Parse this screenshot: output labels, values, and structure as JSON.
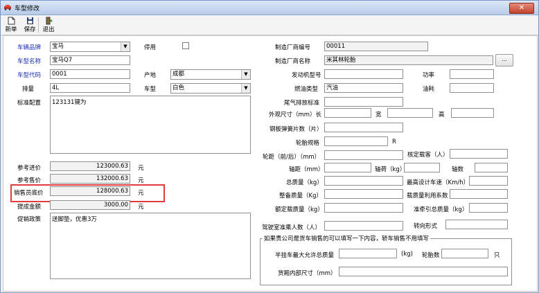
{
  "window": {
    "title": "车型修改",
    "close_glyph": "✕"
  },
  "toolbar": {
    "new_label": "新单",
    "save_label": "保存",
    "exit_label": "退出"
  },
  "left": {
    "brand_label": "车辆品牌",
    "brand_value": "宝马",
    "disabled_label": "停用",
    "model_name_label": "车型名称",
    "model_name_value": "宝马Q7",
    "model_code_label": "车型代码",
    "model_code_value": "0001",
    "origin_label": "产地",
    "origin_value": "成都",
    "displacement_label": "排量",
    "displacement_value": "4L",
    "type_label": "车型",
    "type_value": "白色",
    "config_label": "标准配置",
    "config_value": "123131键为",
    "ref_cost_label": "参考进价",
    "ref_cost_value": "123000.63",
    "ref_cost_unit": "元",
    "ref_price_label": "参考售价",
    "ref_price_value": "132000.63",
    "ref_price_unit": "元",
    "min_price_label": "销售员底价",
    "min_price_value": "128000.63",
    "min_price_unit": "元",
    "commission_label": "提成金额",
    "commission_value": "3000.00",
    "commission_unit": "元",
    "promo_label": "促销政策",
    "promo_value": "送脚垫，优惠3万"
  },
  "right": {
    "mfr_code_label": "制造厂商编号",
    "mfr_code_value": "00011",
    "mfr_name_label": "制造厂商名称",
    "mfr_name_value": "米其林轮胎",
    "browse_label": "...",
    "engine_label": "发动机型号",
    "power_label": "功率",
    "fuel_label": "燃油类型",
    "fuel_value": "汽油",
    "consumption_label": "油耗",
    "emission_label": "尾气排放标准",
    "size_label": "外观尺寸（mm）长",
    "width_label": "宽",
    "height_label": "高",
    "spring_label": "钢板弹簧片数（片）",
    "tire_label": "轮胎规格",
    "tire_unit": "R",
    "track_label": "轮距（前/后）（mm）",
    "seats_label": "核定载客（人）",
    "wheelbase_label": "轴距（mm）",
    "axleload_label": "轴荷（kg）",
    "axles_label": "轴数",
    "total_mass_label": "总质量（kg）",
    "max_speed_label": "最高设计车速（Km/h）",
    "curb_mass_label": "整备质量（Kg）",
    "load_util_label": "载质量利用系数",
    "rated_load_label": "额定载质量（kg）",
    "tow_mass_label": "准牵引总质量（kg）",
    "cab_pass_label": "驾驶室准乘人数（人）",
    "steering_label": "转向形式",
    "group_title": "如果贵公司是货车销售的可以填写一下内容，轿车销售不用填写",
    "semi_mass_label": "半挂车最大允许总质量",
    "semi_unit": "(kg)",
    "tire_count_label": "轮胎数",
    "tire_count_unit": "只",
    "cargo_size_label": "货厢内部尺寸（mm）"
  },
  "colors": {
    "accent_red": "#e23b3b",
    "label_blue": "#1a2fb0"
  }
}
